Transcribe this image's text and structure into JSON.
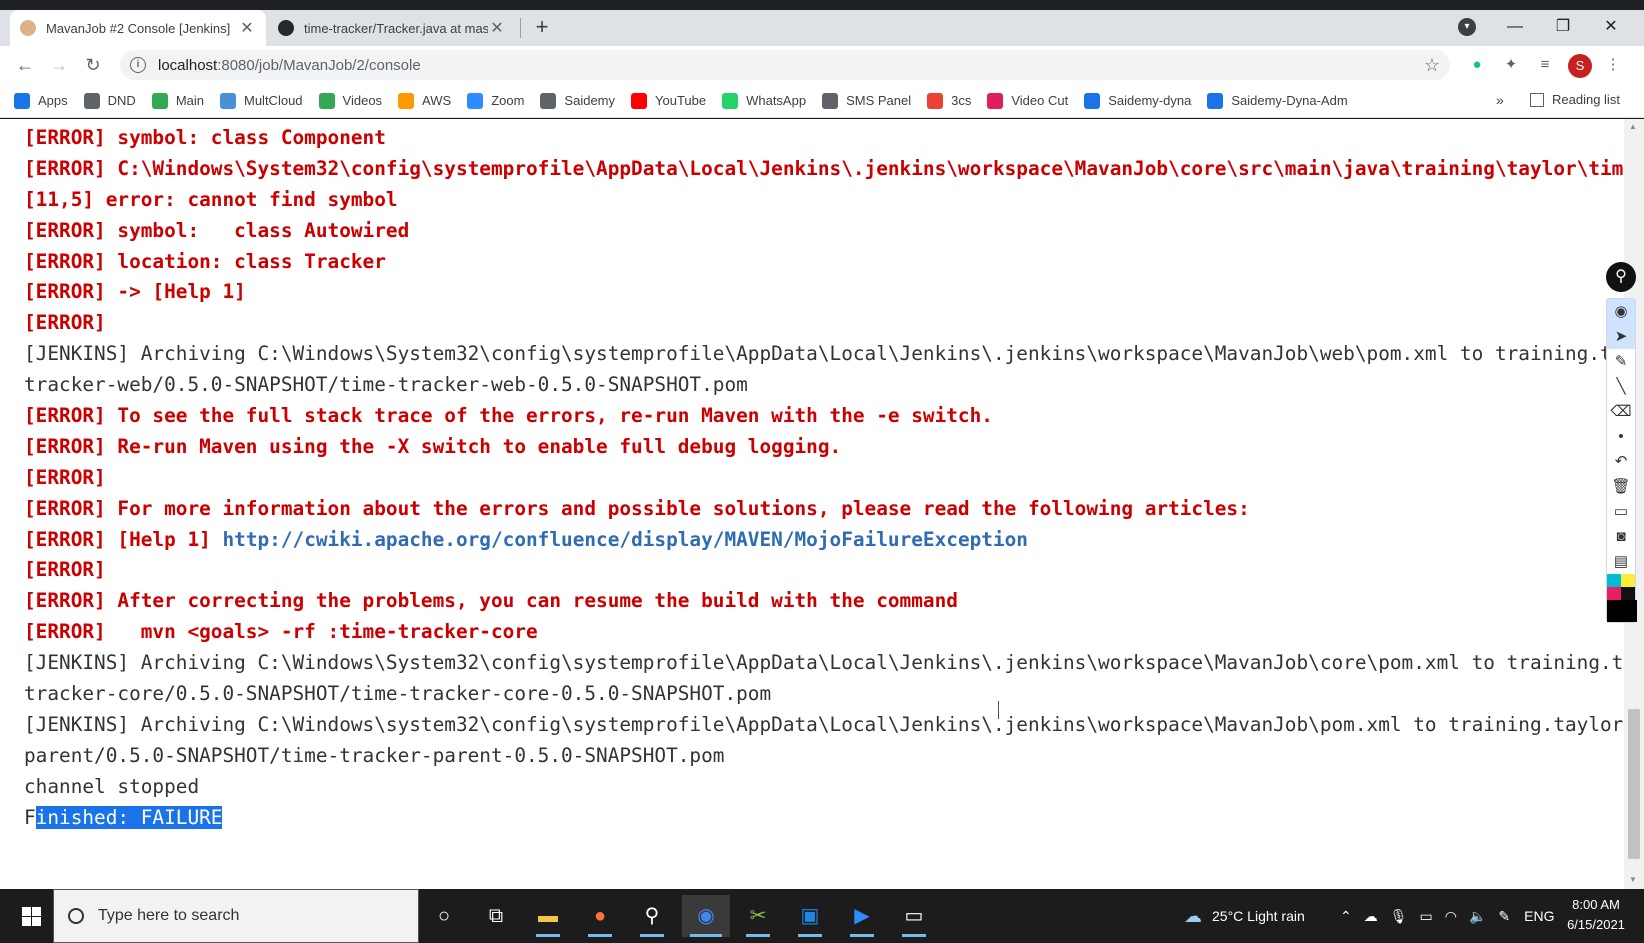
{
  "browser": {
    "tabs": [
      {
        "title": "MavanJob #2 Console [Jenkins]",
        "active": true
      },
      {
        "title": "time-tracker/Tracker.java at mast",
        "active": false
      }
    ],
    "new_tab": "+",
    "window_controls": {
      "minimize": "—",
      "restore": "❐",
      "close": "✕"
    },
    "address": {
      "host": "localhost",
      "path": ":8080/job/MavanJob/2/console"
    },
    "profile_initial": "S",
    "bookmarks": [
      {
        "label": "Apps",
        "icon": "apps-grid-icon",
        "color": "#1a73e8"
      },
      {
        "label": "DND",
        "icon": "globe-icon",
        "color": "#5f6368"
      },
      {
        "label": "Main",
        "icon": "drive-icon",
        "color": "#34a853"
      },
      {
        "label": "MultCloud",
        "icon": "cloud-icon",
        "color": "#4a90d9"
      },
      {
        "label": "Videos",
        "icon": "drive-icon",
        "color": "#34a853"
      },
      {
        "label": "AWS",
        "icon": "aws-icon",
        "color": "#ff9900"
      },
      {
        "label": "Zoom",
        "icon": "zoom-icon",
        "color": "#2d8cff"
      },
      {
        "label": "Saidemy",
        "icon": "dollar-icon",
        "color": "#5f6368"
      },
      {
        "label": "YouTube",
        "icon": "youtube-icon",
        "color": "#ff0000"
      },
      {
        "label": "WhatsApp",
        "icon": "whatsapp-icon",
        "color": "#25d366"
      },
      {
        "label": "SMS Panel",
        "icon": "globe-icon",
        "color": "#5f6368"
      },
      {
        "label": "3cs",
        "icon": "gmail-icon",
        "color": "#ea4335"
      },
      {
        "label": "Video Cut",
        "icon": "slack-icon",
        "color": "#e01e5a"
      },
      {
        "label": "Saidemy-dyna",
        "icon": "image-icon",
        "color": "#1a73e8"
      },
      {
        "label": "Saidemy-Dyna-Adm",
        "icon": "x-icon",
        "color": "#1a73e8"
      }
    ],
    "bookmarks_more": "»",
    "reading_list": "Reading list"
  },
  "console": {
    "lines": [
      {
        "type": "err",
        "text": "[ERROR] symbol: class Component"
      },
      {
        "type": "err",
        "text": "[ERROR] C:\\Windows\\System32\\config\\systemprofile\\AppData\\Local\\Jenkins\\.jenkins\\workspace\\MavanJob\\core\\src\\main\\java\\training\\taylor\\tim"
      },
      {
        "type": "err",
        "text": "[11,5] error: cannot find symbol"
      },
      {
        "type": "err",
        "text": "[ERROR] symbol:   class Autowired"
      },
      {
        "type": "err",
        "text": "[ERROR] location: class Tracker"
      },
      {
        "type": "err",
        "text": "[ERROR] -> [Help 1]"
      },
      {
        "type": "err",
        "text": "[ERROR]"
      },
      {
        "type": "plain",
        "text": "[JENKINS] Archiving C:\\Windows\\System32\\config\\systemprofile\\AppData\\Local\\Jenkins\\.jenkins\\workspace\\MavanJob\\web\\pom.xml to training.t"
      },
      {
        "type": "plain",
        "text": "tracker-web/0.5.0-SNAPSHOT/time-tracker-web-0.5.0-SNAPSHOT.pom"
      },
      {
        "type": "err",
        "text": "[ERROR] To see the full stack trace of the errors, re-run Maven with the -e switch."
      },
      {
        "type": "err",
        "text": "[ERROR] Re-run Maven using the -X switch to enable full debug logging."
      },
      {
        "type": "err",
        "text": "[ERROR]"
      },
      {
        "type": "err",
        "text": "[ERROR] For more information about the errors and possible solutions, please read the following articles:"
      },
      {
        "type": "err",
        "text": "[ERROR] [Help 1] ",
        "link": "http://cwiki.apache.org/confluence/display/MAVEN/MojoFailureException"
      },
      {
        "type": "err",
        "text": "[ERROR]"
      },
      {
        "type": "err",
        "text": "[ERROR] After correcting the problems, you can resume the build with the command"
      },
      {
        "type": "err",
        "text": "[ERROR]   mvn <goals> -rf :time-tracker-core"
      },
      {
        "type": "plain",
        "text": "[JENKINS] Archiving C:\\Windows\\System32\\config\\systemprofile\\AppData\\Local\\Jenkins\\.jenkins\\workspace\\MavanJob\\core\\pom.xml to training.t"
      },
      {
        "type": "plain",
        "text": "tracker-core/0.5.0-SNAPSHOT/time-tracker-core-0.5.0-SNAPSHOT.pom"
      },
      {
        "type": "plain",
        "text": "[JENKINS] Archiving C:\\Windows\\system32\\config\\systemprofile\\AppData\\Local\\Jenkins\\.jenkins\\workspace\\MavanJob\\pom.xml to training.taylor"
      },
      {
        "type": "plain",
        "text": "parent/0.5.0-SNAPSHOT/time-tracker-parent-0.5.0-SNAPSHOT.pom"
      },
      {
        "type": "plain",
        "text": "channel stopped"
      }
    ],
    "final_prefix": "F",
    "final_selected": "inished: FAILURE"
  },
  "taskbar": {
    "search_placeholder": "Type here to search",
    "weather": "25°C  Light rain",
    "language": "ENG",
    "time": "8:00 AM",
    "date": "6/15/2021"
  },
  "colors": {
    "error_text": "#cc0000",
    "link": "#2f6cb3",
    "selection": "#1a73e8"
  }
}
